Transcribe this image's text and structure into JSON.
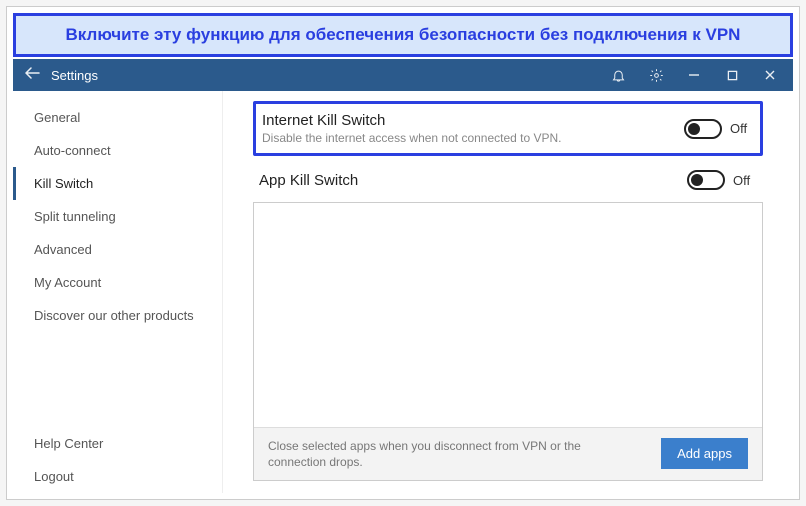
{
  "banner": {
    "text": "Включите эту функцию для обеспечения безопасности без подключения к VPN"
  },
  "titlebar": {
    "title": "Settings"
  },
  "sidebar": {
    "items": [
      {
        "label": "General",
        "id": "general",
        "active": false
      },
      {
        "label": "Auto-connect",
        "id": "auto-connect",
        "active": false
      },
      {
        "label": "Kill Switch",
        "id": "kill-switch",
        "active": true
      },
      {
        "label": "Split tunneling",
        "id": "split-tunneling",
        "active": false
      },
      {
        "label": "Advanced",
        "id": "advanced",
        "active": false
      },
      {
        "label": "My Account",
        "id": "my-account",
        "active": false
      },
      {
        "label": "Discover our other products",
        "id": "discover",
        "active": false
      }
    ],
    "footer_items": [
      {
        "label": "Help Center",
        "id": "help-center"
      },
      {
        "label": "Logout",
        "id": "logout"
      }
    ]
  },
  "content": {
    "internet_kill": {
      "title": "Internet Kill Switch",
      "subtitle": "Disable the internet access when not connected to VPN.",
      "state_label": "Off"
    },
    "app_kill": {
      "title": "App Kill Switch",
      "state_label": "Off"
    },
    "footer_text": "Close selected apps when you disconnect from VPN or the connection drops.",
    "add_button": "Add apps"
  }
}
